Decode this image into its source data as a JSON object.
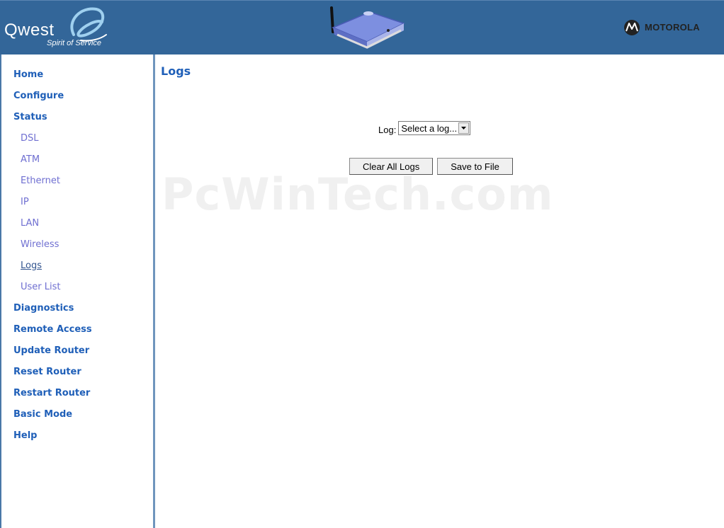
{
  "header": {
    "logo_text": "Qwest",
    "logo_tagline": "Spirit of Service",
    "brand_right": "MOTOROLA",
    "accent_color": "#336699"
  },
  "sidebar": {
    "items": [
      {
        "label": "Home",
        "level": "main"
      },
      {
        "label": "Configure",
        "level": "main"
      },
      {
        "label": "Status",
        "level": "main"
      },
      {
        "label": "DSL",
        "level": "sub"
      },
      {
        "label": "ATM",
        "level": "sub"
      },
      {
        "label": "Ethernet",
        "level": "sub"
      },
      {
        "label": "IP",
        "level": "sub"
      },
      {
        "label": "LAN",
        "level": "sub"
      },
      {
        "label": "Wireless",
        "level": "sub"
      },
      {
        "label": "Logs",
        "level": "sub",
        "active": true
      },
      {
        "label": "User List",
        "level": "sub"
      },
      {
        "label": "Diagnostics",
        "level": "main"
      },
      {
        "label": "Remote Access",
        "level": "main"
      },
      {
        "label": "Update Router",
        "level": "main"
      },
      {
        "label": "Reset Router",
        "level": "main"
      },
      {
        "label": "Restart Router",
        "level": "main"
      },
      {
        "label": "Basic Mode",
        "level": "main"
      },
      {
        "label": "Help",
        "level": "main"
      }
    ]
  },
  "main": {
    "title": "Logs",
    "log_label": "Log:",
    "log_select_value": "Select a log...",
    "clear_button": "Clear All Logs",
    "save_button": "Save to File"
  },
  "watermark": "PcWinTech.com"
}
